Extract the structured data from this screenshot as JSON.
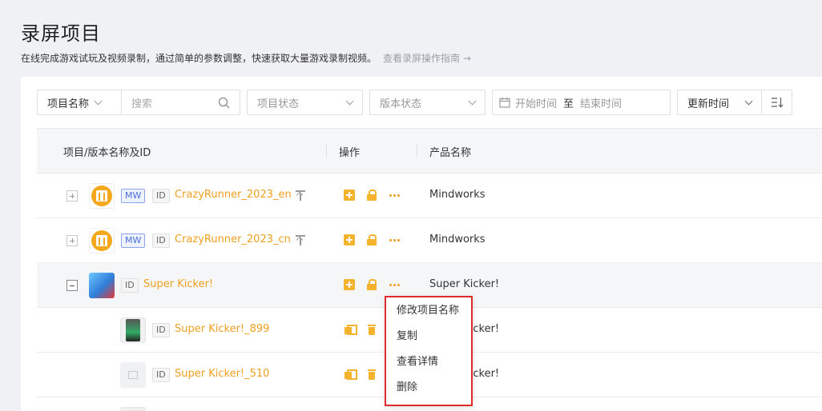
{
  "header": {
    "title": "录屏项目",
    "description": "在线完成游戏试玩及视频录制，通过简单的参数调整，快速获取大量游戏录制视频。",
    "guide_link": "查看录屏操作指南 →"
  },
  "filters": {
    "name_field_label": "项目名称",
    "search_placeholder": "搜索",
    "project_status_placeholder": "项目状态",
    "version_status_placeholder": "版本状态",
    "start_date_placeholder": "开始时间",
    "date_separator": "至",
    "end_date_placeholder": "结束时间",
    "sort_label": "更新时间"
  },
  "table": {
    "columns": {
      "name": "项目/版本名称及ID",
      "actions": "操作",
      "product": "产品名称"
    },
    "rows": [
      {
        "name": "CrazyRunner_2023_en",
        "tag": "MW",
        "id_tag": "ID",
        "product": "Mindworks"
      },
      {
        "name": "CrazyRunner_2023_cn",
        "tag": "MW",
        "id_tag": "ID",
        "product": "Mindworks"
      },
      {
        "name": "Super Kicker!",
        "id_tag": "ID",
        "product": "Super Kicker!"
      },
      {
        "name": "Super Kicker!_899",
        "id_tag": "ID",
        "product": "Super Kicker!"
      },
      {
        "name": "Super Kicker!_510",
        "id_tag": "ID",
        "product": "Super Kicker!"
      }
    ]
  },
  "context_menu": {
    "items": [
      "修改项目名称",
      "复制",
      "查看详情",
      "删除"
    ]
  },
  "colors": {
    "accent": "#f0a020",
    "highlight_border": "#e02b2b",
    "tag_mw": "#4b6fd6"
  }
}
